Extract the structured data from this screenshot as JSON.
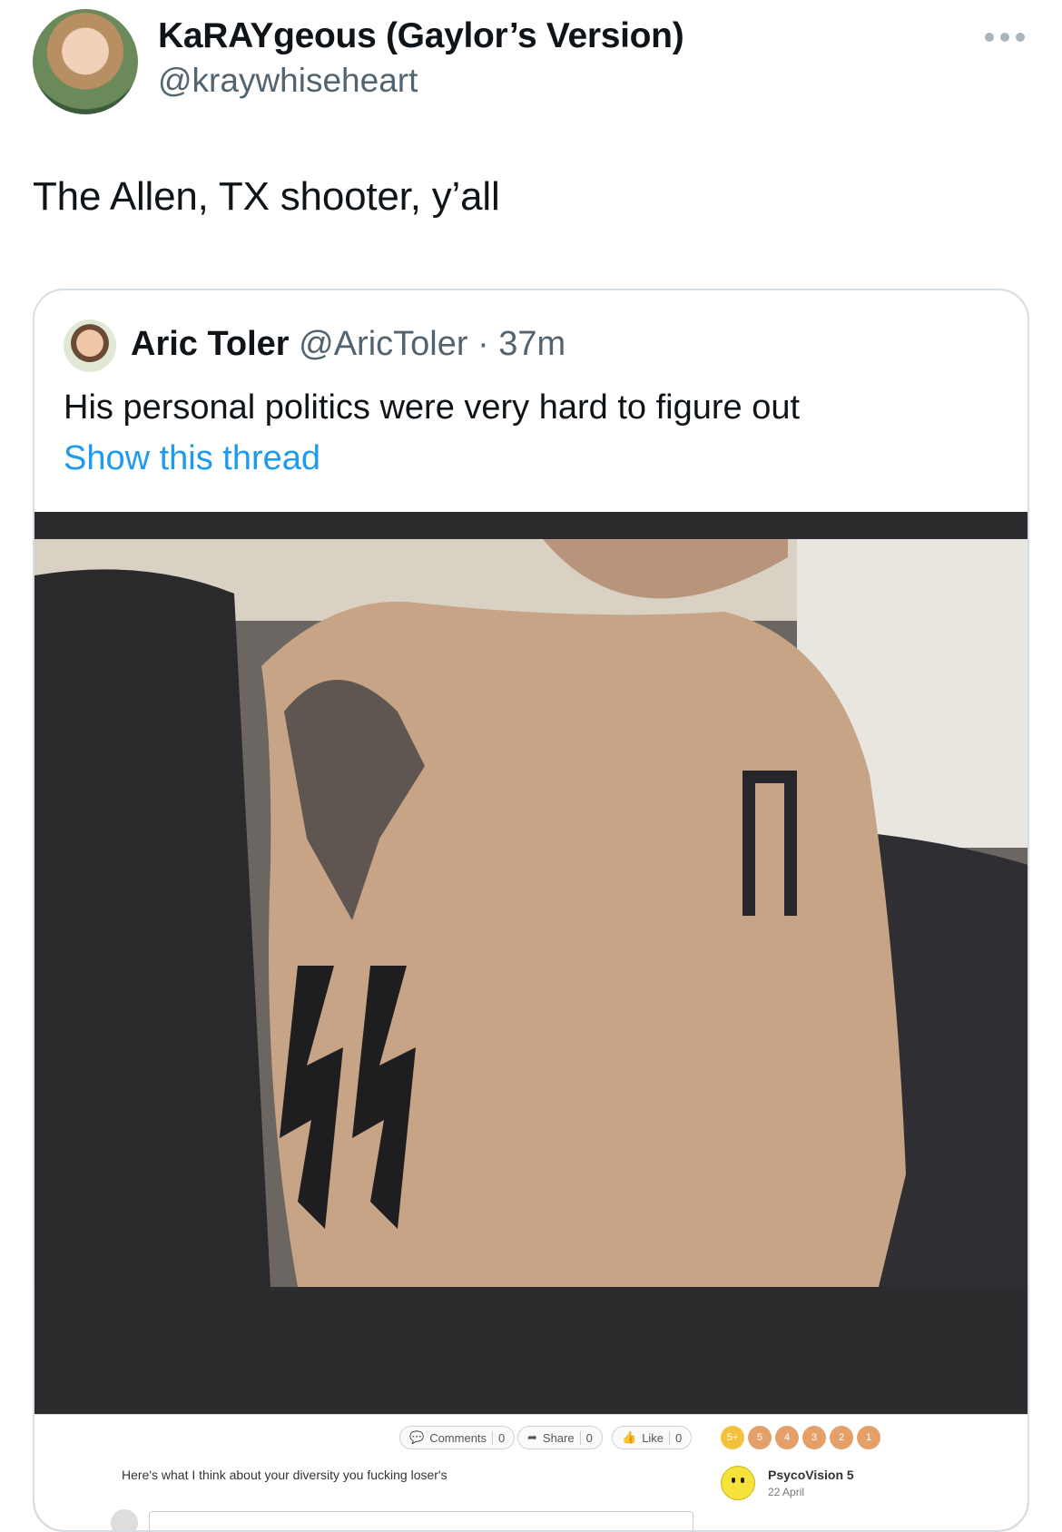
{
  "tweet": {
    "author_name": "KaRAYgeous (Gaylor’s Version)",
    "author_handle": "@kraywhiseheart",
    "avatar_icon": "profile-photo",
    "more_icon": "more-horizontal-icon",
    "text": "The Allen, TX shooter, y’all"
  },
  "quote": {
    "author_name": "Aric Toler",
    "author_handle": "@AricToler",
    "time": "· 37m",
    "text": "His personal politics were very hard to figure out",
    "link_label": "Show this thread",
    "link_color": "#1d9bf0"
  },
  "embedded_screenshot": {
    "comments_label": "Comments",
    "comments_count": "0",
    "share_label": "Share",
    "share_count": "0",
    "like_label": "Like",
    "like_count": "0",
    "ranks": [
      "5+",
      "5",
      "4",
      "3",
      "2",
      "1"
    ],
    "post_text": "Here's what I think about your diversity you fucking loser's",
    "poster_name": "PsycoVision 5",
    "poster_date": "22 April"
  }
}
